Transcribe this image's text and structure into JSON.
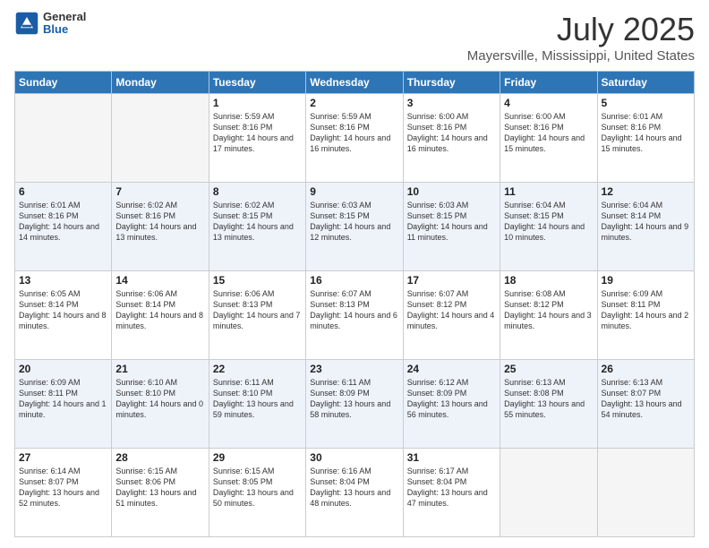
{
  "logo": {
    "general": "General",
    "blue": "Blue"
  },
  "title": "July 2025",
  "subtitle": "Mayersville, Mississippi, United States",
  "days_of_week": [
    "Sunday",
    "Monday",
    "Tuesday",
    "Wednesday",
    "Thursday",
    "Friday",
    "Saturday"
  ],
  "weeks": [
    [
      {
        "day": "",
        "info": ""
      },
      {
        "day": "",
        "info": ""
      },
      {
        "day": "1",
        "info": "Sunrise: 5:59 AM\nSunset: 8:16 PM\nDaylight: 14 hours and 17 minutes."
      },
      {
        "day": "2",
        "info": "Sunrise: 5:59 AM\nSunset: 8:16 PM\nDaylight: 14 hours and 16 minutes."
      },
      {
        "day": "3",
        "info": "Sunrise: 6:00 AM\nSunset: 8:16 PM\nDaylight: 14 hours and 16 minutes."
      },
      {
        "day": "4",
        "info": "Sunrise: 6:00 AM\nSunset: 8:16 PM\nDaylight: 14 hours and 15 minutes."
      },
      {
        "day": "5",
        "info": "Sunrise: 6:01 AM\nSunset: 8:16 PM\nDaylight: 14 hours and 15 minutes."
      }
    ],
    [
      {
        "day": "6",
        "info": "Sunrise: 6:01 AM\nSunset: 8:16 PM\nDaylight: 14 hours and 14 minutes."
      },
      {
        "day": "7",
        "info": "Sunrise: 6:02 AM\nSunset: 8:16 PM\nDaylight: 14 hours and 13 minutes."
      },
      {
        "day": "8",
        "info": "Sunrise: 6:02 AM\nSunset: 8:15 PM\nDaylight: 14 hours and 13 minutes."
      },
      {
        "day": "9",
        "info": "Sunrise: 6:03 AM\nSunset: 8:15 PM\nDaylight: 14 hours and 12 minutes."
      },
      {
        "day": "10",
        "info": "Sunrise: 6:03 AM\nSunset: 8:15 PM\nDaylight: 14 hours and 11 minutes."
      },
      {
        "day": "11",
        "info": "Sunrise: 6:04 AM\nSunset: 8:15 PM\nDaylight: 14 hours and 10 minutes."
      },
      {
        "day": "12",
        "info": "Sunrise: 6:04 AM\nSunset: 8:14 PM\nDaylight: 14 hours and 9 minutes."
      }
    ],
    [
      {
        "day": "13",
        "info": "Sunrise: 6:05 AM\nSunset: 8:14 PM\nDaylight: 14 hours and 8 minutes."
      },
      {
        "day": "14",
        "info": "Sunrise: 6:06 AM\nSunset: 8:14 PM\nDaylight: 14 hours and 8 minutes."
      },
      {
        "day": "15",
        "info": "Sunrise: 6:06 AM\nSunset: 8:13 PM\nDaylight: 14 hours and 7 minutes."
      },
      {
        "day": "16",
        "info": "Sunrise: 6:07 AM\nSunset: 8:13 PM\nDaylight: 14 hours and 6 minutes."
      },
      {
        "day": "17",
        "info": "Sunrise: 6:07 AM\nSunset: 8:12 PM\nDaylight: 14 hours and 4 minutes."
      },
      {
        "day": "18",
        "info": "Sunrise: 6:08 AM\nSunset: 8:12 PM\nDaylight: 14 hours and 3 minutes."
      },
      {
        "day": "19",
        "info": "Sunrise: 6:09 AM\nSunset: 8:11 PM\nDaylight: 14 hours and 2 minutes."
      }
    ],
    [
      {
        "day": "20",
        "info": "Sunrise: 6:09 AM\nSunset: 8:11 PM\nDaylight: 14 hours and 1 minute."
      },
      {
        "day": "21",
        "info": "Sunrise: 6:10 AM\nSunset: 8:10 PM\nDaylight: 14 hours and 0 minutes."
      },
      {
        "day": "22",
        "info": "Sunrise: 6:11 AM\nSunset: 8:10 PM\nDaylight: 13 hours and 59 minutes."
      },
      {
        "day": "23",
        "info": "Sunrise: 6:11 AM\nSunset: 8:09 PM\nDaylight: 13 hours and 58 minutes."
      },
      {
        "day": "24",
        "info": "Sunrise: 6:12 AM\nSunset: 8:09 PM\nDaylight: 13 hours and 56 minutes."
      },
      {
        "day": "25",
        "info": "Sunrise: 6:13 AM\nSunset: 8:08 PM\nDaylight: 13 hours and 55 minutes."
      },
      {
        "day": "26",
        "info": "Sunrise: 6:13 AM\nSunset: 8:07 PM\nDaylight: 13 hours and 54 minutes."
      }
    ],
    [
      {
        "day": "27",
        "info": "Sunrise: 6:14 AM\nSunset: 8:07 PM\nDaylight: 13 hours and 52 minutes."
      },
      {
        "day": "28",
        "info": "Sunrise: 6:15 AM\nSunset: 8:06 PM\nDaylight: 13 hours and 51 minutes."
      },
      {
        "day": "29",
        "info": "Sunrise: 6:15 AM\nSunset: 8:05 PM\nDaylight: 13 hours and 50 minutes."
      },
      {
        "day": "30",
        "info": "Sunrise: 6:16 AM\nSunset: 8:04 PM\nDaylight: 13 hours and 48 minutes."
      },
      {
        "day": "31",
        "info": "Sunrise: 6:17 AM\nSunset: 8:04 PM\nDaylight: 13 hours and 47 minutes."
      },
      {
        "day": "",
        "info": ""
      },
      {
        "day": "",
        "info": ""
      }
    ]
  ]
}
